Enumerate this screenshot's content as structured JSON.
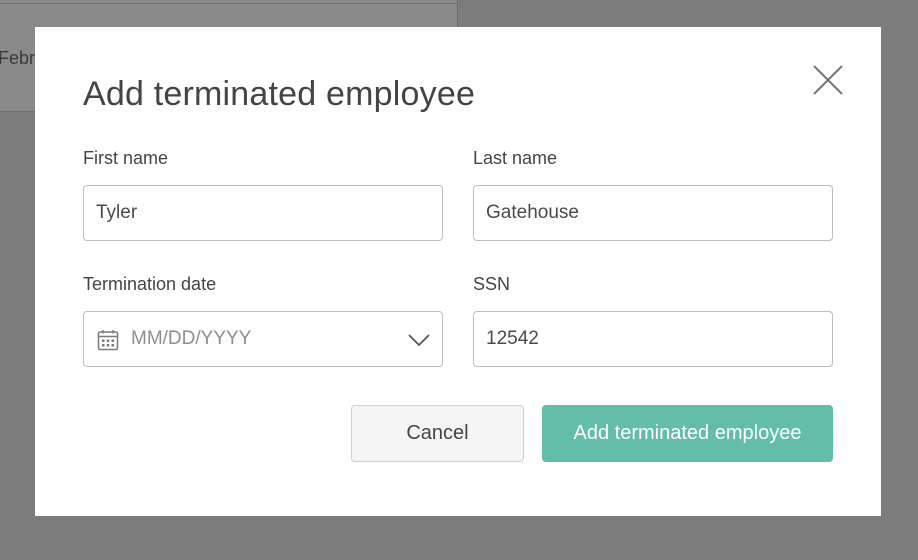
{
  "background": {
    "partial_text": "Febr"
  },
  "modal": {
    "title": "Add terminated employee",
    "close_icon": "close-icon",
    "fields": {
      "first_name": {
        "label": "First name",
        "value": "Tyler"
      },
      "last_name": {
        "label": "Last name",
        "value": "Gatehouse"
      },
      "termination_date": {
        "label": "Termination date",
        "value": "",
        "placeholder": "MM/DD/YYYY",
        "icon": "calendar-icon",
        "dropdown_icon": "chevron-down-icon"
      },
      "ssn": {
        "label": "SSN",
        "value": "12542"
      }
    },
    "buttons": {
      "cancel": "Cancel",
      "submit": "Add terminated employee"
    }
  },
  "colors": {
    "overlay": "#7c7c7c",
    "accent": "#63bda8",
    "text": "#444444",
    "border": "#bdbdbd"
  }
}
